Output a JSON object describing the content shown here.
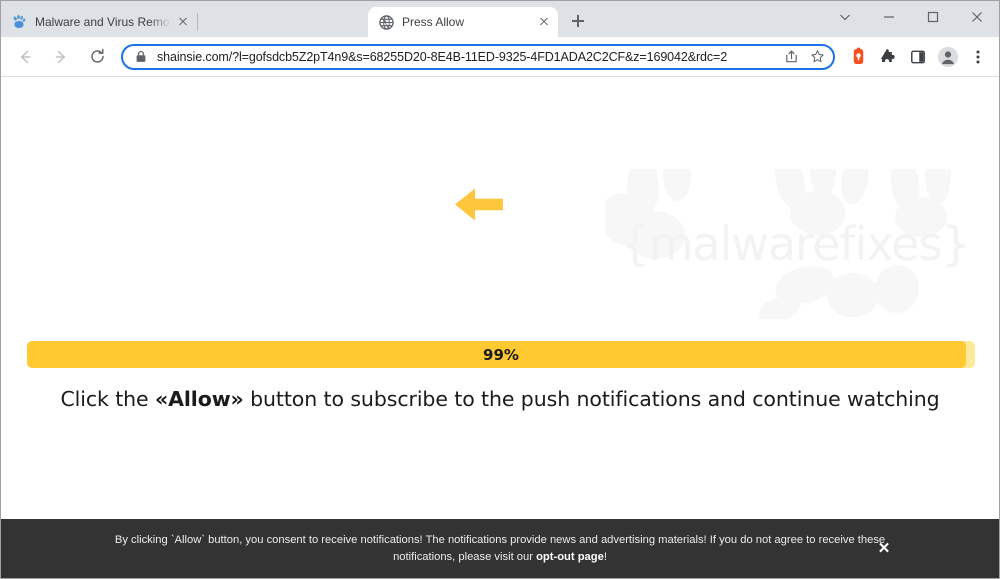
{
  "browser": {
    "tabs": [
      {
        "title": "Malware and Virus Removal Guid",
        "favicon": "paw-icon",
        "active": false
      },
      {
        "title": "Press Allow",
        "favicon": "globe-icon",
        "active": true
      }
    ],
    "new_tab_label": "+",
    "window_controls": {
      "tab_search": "chevron-down-icon",
      "minimize": "minimize-icon",
      "maximize": "maximize-icon",
      "close": "close-icon"
    },
    "toolbar": {
      "back": "back-arrow-icon",
      "forward": "forward-arrow-icon",
      "reload": "reload-icon",
      "site_security": "lock-icon",
      "url": "shainsie.com/?l=gofsdcb5Z2pT4n9&s=68255D20-8E4B-11ED-9325-4FD1ADA2C2CF&z=169042&rdc=2",
      "url_domain": "shainsie.com",
      "share": "share-icon",
      "bookmark": "star-icon",
      "extension_alert": "extension-orange-icon",
      "extensions": "puzzle-piece-icon",
      "side_panel": "side-panel-icon",
      "profile": "profile-avatar-icon",
      "menu": "three-dot-menu-icon"
    }
  },
  "page": {
    "watermark": "{malwarefixes}",
    "arrow": "left-arrow-icon",
    "progress": {
      "percent_label": "99%",
      "percent_value": 99,
      "fill_color": "#ffc932",
      "track_color": "#fde99a"
    },
    "headline": {
      "before": "Click the ",
      "emphasis": "«Allow»",
      "after": " button to subscribe to the push notifications and continue watching"
    },
    "consent_banner": {
      "line1_before": "By clicking `Allow` button, you consent to receive notifications! The notifications provide news and advertising materials! If you do not agree to receive these notifications,",
      "line2_before": "please visit our ",
      "link_text": "opt-out page",
      "line2_after": "!",
      "close_label": "✕",
      "background": "#333333"
    }
  }
}
